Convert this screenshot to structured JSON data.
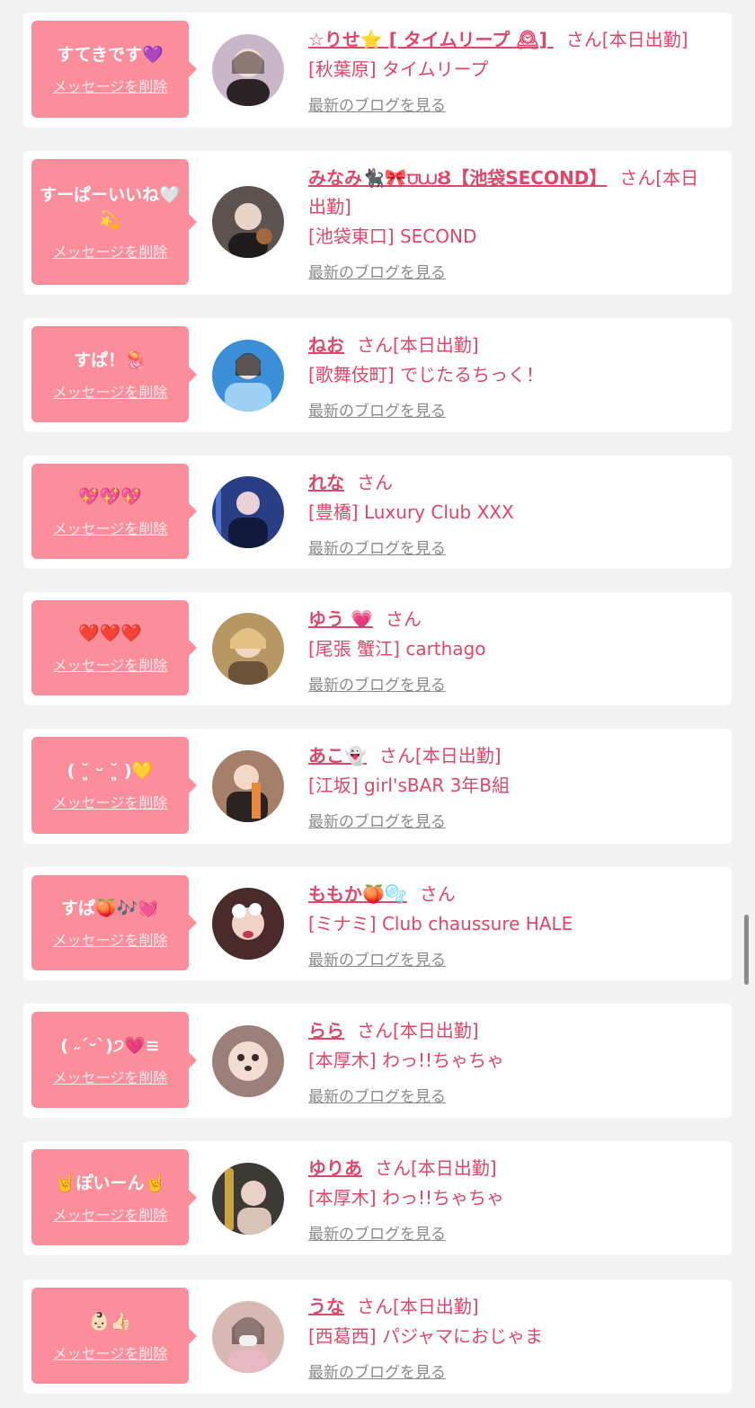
{
  "entries": [
    {
      "message": "すてきです💜",
      "delete_label": "メッセージを削除",
      "name": "☆りせ⭐ [ タイムリープ 🕰] ",
      "suffix": "さん[本日出勤]",
      "shop": "[秋葉原] タイムリープ",
      "blog_label": "最新のブログを見る",
      "avatar_color": "#c9b6c9"
    },
    {
      "message": "すーぱーいいね🤍💫",
      "delete_label": "メッセージを削除",
      "name": "みなみ🐈‍⬛🎀⩌⩊Ȣ【池袋SECOND】",
      "suffix": "さん[本日出勤]",
      "shop": "[池袋東口] SECOND",
      "blog_label": "最新のブログを見る",
      "avatar_color": "#5d5350"
    },
    {
      "message": "すぱ！🪼",
      "delete_label": "メッセージを削除",
      "name": "ねお",
      "suffix": "さん[本日出勤]",
      "shop": "[歌舞伎町] でじたるちっく！",
      "blog_label": "最新のブログを見る",
      "avatar_color": "#3c8fd6"
    },
    {
      "message": "💖💖💖",
      "delete_label": "メッセージを削除",
      "name": "れな",
      "suffix": "さん",
      "shop": "[豊橋] Luxury Club XXX",
      "blog_label": "最新のブログを見る",
      "avatar_color": "#2a3e86"
    },
    {
      "message": "❤️❤️❤️",
      "delete_label": "メッセージを削除",
      "name": "ゆう 💗",
      "suffix": "さん",
      "shop": "[尾張 蟹江] carthago",
      "blog_label": "最新のブログを見る",
      "avatar_color": "#b69764"
    },
    {
      "message": "( ˘͈ ᵕ ˘͈ )💛",
      "delete_label": "メッセージを削除",
      "name": "あこ👻",
      "suffix": "さん[本日出勤]",
      "shop": "[江坂] girl'sBAR 3年B組",
      "blog_label": "最新のブログを見る",
      "avatar_color": "#a67f6a"
    },
    {
      "message": "すぱ🍑🎶💓",
      "delete_label": "メッセージを削除",
      "name": "ももか🍑🫧",
      "suffix": "さん",
      "shop": "[ミナミ] Club chaussure HALE",
      "blog_label": "最新のブログを見る",
      "avatar_color": "#4a2a2a"
    },
    {
      "message": "( ˶ˊᵕˋ)੭💗≡",
      "delete_label": "メッセージを削除",
      "name": "らら",
      "suffix": "さん[本日出勤]",
      "shop": "[本厚木] わっ!!ちゃちゃ",
      "blog_label": "最新のブログを見る",
      "avatar_color": "#9c7f78"
    },
    {
      "message": "🤘ぽいーん🤘",
      "delete_label": "メッセージを削除",
      "name": "ゆりあ",
      "suffix": "さん[本日出勤]",
      "shop": "[本厚木] わっ!!ちゃちゃ",
      "blog_label": "最新のブログを見る",
      "avatar_color": "#3d3a36"
    },
    {
      "message": "👶🏻👍🏻",
      "delete_label": "メッセージを削除",
      "name": "うな",
      "suffix": "さん[本日出勤]",
      "shop": "[西葛西] パジャマにおじゃま",
      "blog_label": "最新のブログを見る",
      "avatar_color": "#d8b8b2"
    }
  ]
}
